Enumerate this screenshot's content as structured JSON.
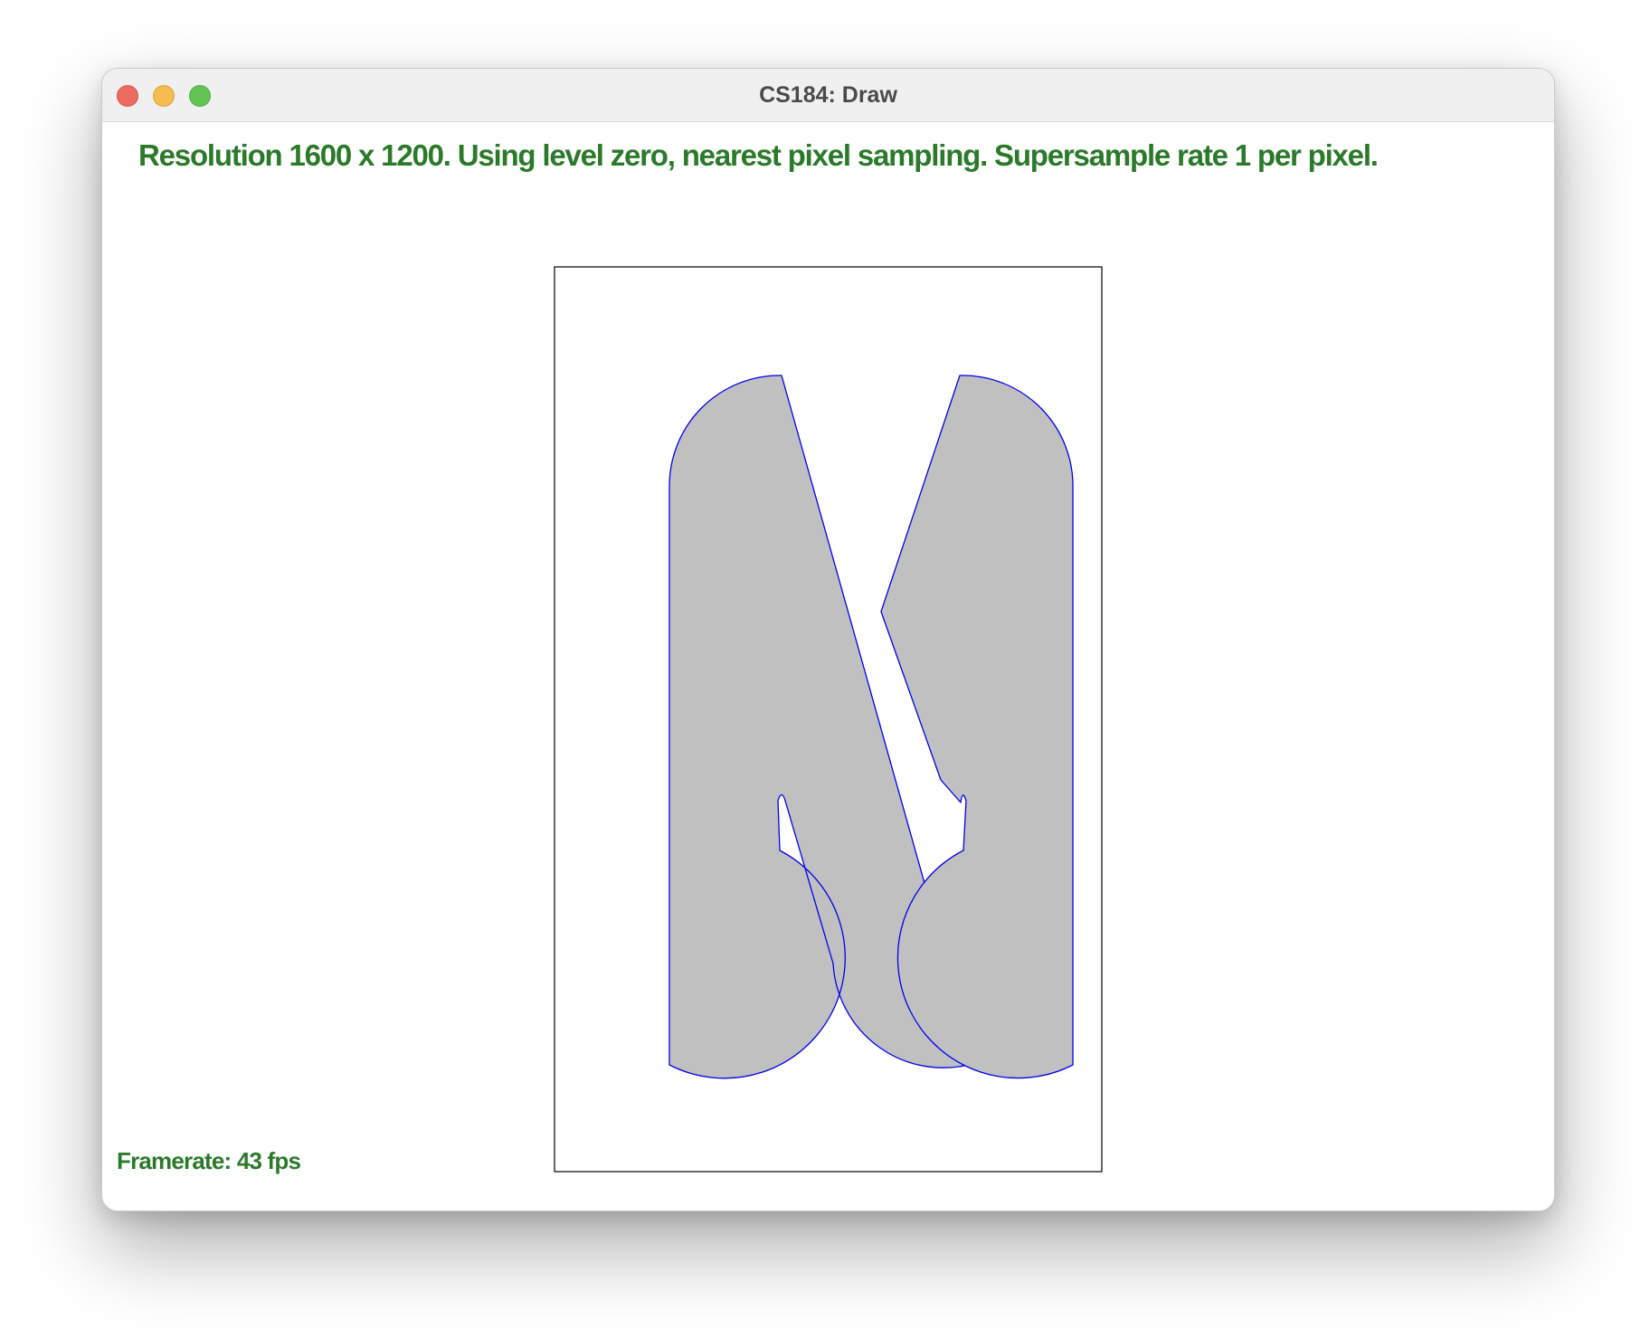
{
  "window": {
    "title": "CS184: Draw",
    "controls": {
      "close": "close-icon",
      "minimize": "minimize-icon",
      "maximize": "maximize-icon"
    }
  },
  "status": {
    "info_line": "Resolution 1600 x 1200. Using level zero, nearest pixel sampling. Supersample rate 1 per pixel.",
    "framerate": "Framerate: 43 fps"
  },
  "colors": {
    "status_text": "#2a7a2a",
    "shape_fill": "#c0c0c0",
    "shape_outline": "#0000ee",
    "frame_border": "#000000"
  }
}
